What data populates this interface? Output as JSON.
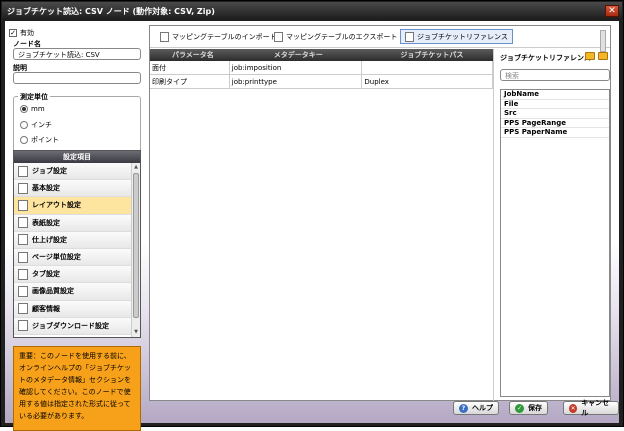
{
  "window": {
    "title": "ジョブチケット読込: CSV ノード (動作対象: CSV, Zip)",
    "close_label": "✕"
  },
  "left": {
    "enabled_label": "有効",
    "enabled_checked": true,
    "node_name_label": "ノード名",
    "node_name_value": "ジョブチケット読込: CSV",
    "description_label": "説明",
    "description_value": "",
    "unit_legend": "測定単位",
    "units": [
      {
        "label": "mm",
        "selected": true
      },
      {
        "label": "インチ",
        "selected": false
      },
      {
        "label": "ポイント",
        "selected": false
      }
    ],
    "settings_header": "設定項目",
    "settings_items": [
      {
        "label": "ジョブ設定",
        "icon": "document-icon",
        "selected": false
      },
      {
        "label": "基本設定",
        "icon": "settings-icon",
        "selected": false
      },
      {
        "label": "レイアウト設定",
        "icon": "layout-icon",
        "selected": true
      },
      {
        "label": "表紙設定",
        "icon": "cover-icon",
        "selected": false
      },
      {
        "label": "仕上げ設定",
        "icon": "finishing-icon",
        "selected": false
      },
      {
        "label": "ページ単位設定",
        "icon": "page-icon",
        "selected": false
      },
      {
        "label": "タブ設定",
        "icon": "tab-icon",
        "selected": false
      },
      {
        "label": "画像品質設定",
        "icon": "image-icon",
        "selected": false
      },
      {
        "label": "顧客情報",
        "icon": "customer-icon",
        "selected": false
      },
      {
        "label": "ジョブダウンロード設定",
        "icon": "download-icon",
        "selected": false
      }
    ],
    "notice": "重要：このノードを使用する前に、オンラインヘルプの「ジョブチケットのメタデータ情報」セクションを確認してください。このノードで使用する値は指定された形式に従っている必要があります。"
  },
  "toolbar": {
    "import_label": "マッピングテーブルのインポート",
    "export_label": "マッピングテーブルのエクスポート",
    "reference_label": "ジョブチケットリファレンス"
  },
  "grid": {
    "headers": [
      "パラメータ名",
      "メタデータキー",
      "ジョブチケットパス"
    ],
    "rows": [
      [
        "面付",
        "job:imposition",
        ""
      ],
      [
        "印刷タイプ",
        "job:printtype",
        "Duplex"
      ]
    ]
  },
  "reference": {
    "title": "ジョブチケットリファレンス",
    "search_placeholder": "検索",
    "items": [
      "JobName",
      "File",
      "Src",
      "PPS PageRange",
      "PPS PaperName"
    ]
  },
  "buttons": {
    "help": "ヘルプ",
    "save": "保存",
    "cancel": "キャンセル"
  },
  "colors": {
    "accent_selected": "#fde5a0",
    "notice_bg": "#f7a11a"
  }
}
